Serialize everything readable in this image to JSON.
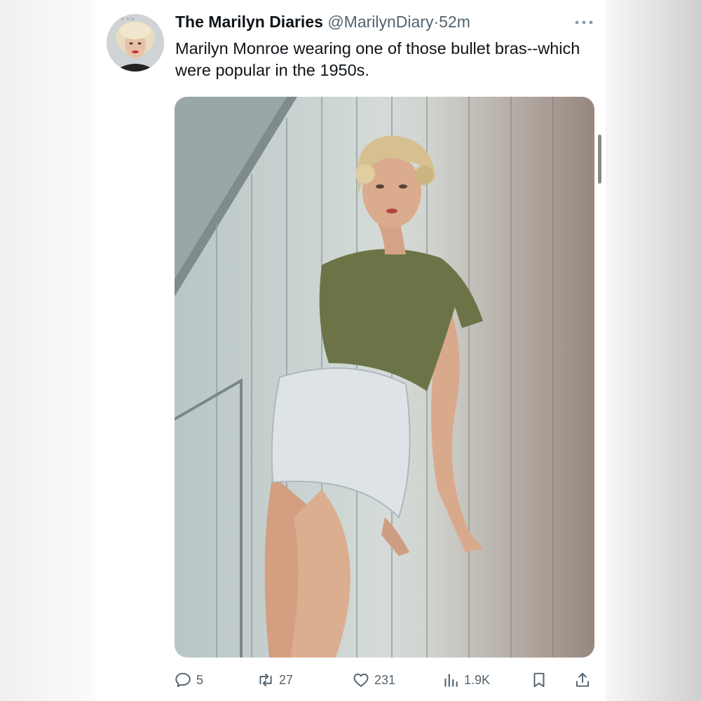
{
  "tweet": {
    "display_name": "The Marilyn Diaries",
    "handle": "@MarilynDiary",
    "separator": "·",
    "time": "52m",
    "text": "Marilyn Monroe wearing one of those bullet bras--which were popular in the 1950s.",
    "avatar_icon": "profile-photo-marilyn",
    "more_icon": "more-horizontal-icon",
    "media": {
      "description_icon": "photo-woman-leaning-on-wood-wall",
      "colors": {
        "wall": "#c9d2d0",
        "shirt": "#6e7548",
        "shorts": "#dfe4e6",
        "skin": "#d7a889",
        "hair": "#d8c49a"
      }
    }
  },
  "actions": {
    "reply": {
      "icon": "reply-icon",
      "count": "5"
    },
    "retweet": {
      "icon": "retweet-icon",
      "count": "27"
    },
    "like": {
      "icon": "heart-icon",
      "count": "231"
    },
    "views": {
      "icon": "views-chart-icon",
      "count": "1.9K"
    },
    "bookmark": {
      "icon": "bookmark-icon"
    },
    "share": {
      "icon": "share-icon"
    }
  },
  "theme": {
    "text_primary": "#0f1419",
    "text_secondary": "#536471",
    "background": "#ffffff"
  }
}
